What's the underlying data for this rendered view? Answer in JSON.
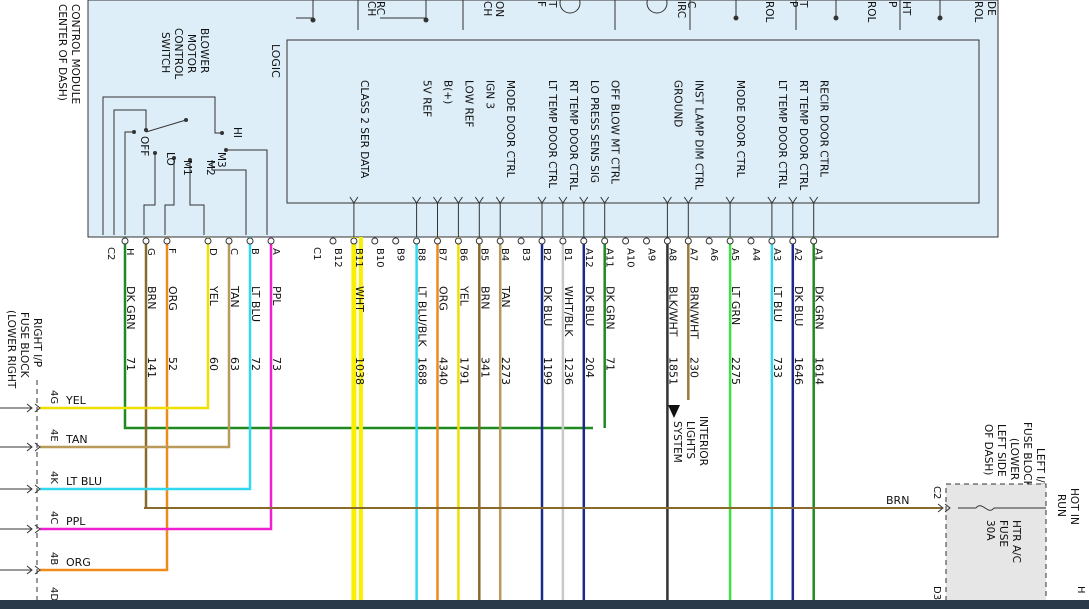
{
  "module": {
    "title_lines": [
      "CONTROL MODULE",
      "CENTER OF DASH)"
    ],
    "logic_label": "LOGIC",
    "top_labels": [
      "RC",
      "CH",
      "ON",
      "CH",
      "T",
      "F",
      "C",
      "IRC",
      "T",
      "P",
      "ROL",
      "HT",
      "P",
      "ROL",
      "DE",
      "ROL"
    ],
    "switch_title": [
      "BLOWER",
      "MOTOR",
      "CONTROL",
      "SWITCH"
    ],
    "switch_positions": [
      "HI",
      "OFF",
      "LO",
      "M1",
      "M2",
      "M3"
    ]
  },
  "connectors": {
    "c2": "C2",
    "c1": "C1"
  },
  "c2_wires": [
    {
      "pin": "H",
      "color_name": "DK GRN",
      "circuit": "71",
      "hex": "#1f8a1f"
    },
    {
      "pin": "G",
      "color_name": "BRN",
      "circuit": "141",
      "hex": "#8a6a2a"
    },
    {
      "pin": "F",
      "color_name": "ORG",
      "circuit": "52",
      "hex": "#f08a1a"
    },
    {
      "pin": "D",
      "color_name": "YEL",
      "circuit": "60",
      "hex": "#f0e000"
    },
    {
      "pin": "C",
      "color_name": "TAN",
      "circuit": "63",
      "hex": "#b89a5a"
    },
    {
      "pin": "B",
      "color_name": "LT BLU",
      "circuit": "72",
      "hex": "#30d8f0"
    },
    {
      "pin": "A",
      "color_name": "PPL",
      "circuit": "73",
      "hex": "#f020d0"
    }
  ],
  "c1_wires": [
    {
      "pin": "B12",
      "func": "",
      "color_name": "",
      "circuit": "",
      "hex": ""
    },
    {
      "pin": "B11",
      "func": "CLASS 2 SER DATA",
      "color_name": "WHT",
      "circuit": "1038",
      "hex": "#f8f000"
    },
    {
      "pin": "B10",
      "func": "",
      "color_name": "",
      "circuit": "",
      "hex": ""
    },
    {
      "pin": "B9",
      "func": "",
      "color_name": "",
      "circuit": "",
      "hex": ""
    },
    {
      "pin": "B8",
      "func": "5V REF",
      "color_name": "LT BLU/BLK",
      "circuit": "1688",
      "hex": "#30d8f0"
    },
    {
      "pin": "B7",
      "func": "B(+)",
      "color_name": "ORG",
      "circuit": "4340",
      "hex": "#f08a1a"
    },
    {
      "pin": "B6",
      "func": "LOW REF",
      "color_name": "YEL",
      "circuit": "1791",
      "hex": "#f0e000"
    },
    {
      "pin": "B5",
      "func": "IGN 3",
      "color_name": "BRN",
      "circuit": "341",
      "hex": "#8a6a2a"
    },
    {
      "pin": "B4",
      "func": "MODE DOOR CTRL",
      "color_name": "TAN",
      "circuit": "2273",
      "hex": "#b89a5a"
    },
    {
      "pin": "B3",
      "func": "",
      "color_name": "",
      "circuit": "",
      "hex": ""
    },
    {
      "pin": "B2",
      "func": "LT TEMP DOOR CTRL",
      "color_name": "DK BLU",
      "circuit": "1199",
      "hex": "#1a2a8a"
    },
    {
      "pin": "B1",
      "func": "RT TEMP DOOR CTRL",
      "color_name": "WHT/BLK",
      "circuit": "1236",
      "hex": "#c8c8c8"
    },
    {
      "pin": "A12",
      "func": "LO PRESS SENS SIG",
      "color_name": "DK BLU",
      "circuit": "204",
      "hex": "#1a2a8a"
    },
    {
      "pin": "A11",
      "func": "OFF BLOW MT CTRL",
      "color_name": "DK GRN",
      "circuit": "71",
      "hex": "#1f8a1f"
    },
    {
      "pin": "A10",
      "func": "",
      "color_name": "",
      "circuit": "",
      "hex": ""
    },
    {
      "pin": "A9",
      "func": "",
      "color_name": "",
      "circuit": "",
      "hex": ""
    },
    {
      "pin": "A8",
      "func": "GROUND",
      "color_name": "BLK/WHT",
      "circuit": "1851",
      "hex": "#333333"
    },
    {
      "pin": "A7",
      "func": "INST LAMP DIM CTRL",
      "color_name": "BRN/WHT",
      "circuit": "230",
      "hex": "#9a7a3a"
    },
    {
      "pin": "A6",
      "func": "",
      "color_name": "",
      "circuit": "",
      "hex": ""
    },
    {
      "pin": "A5",
      "func": "MODE DOOR CTRL",
      "color_name": "LT GRN",
      "circuit": "2275",
      "hex": "#40e040"
    },
    {
      "pin": "A4",
      "func": "",
      "color_name": "",
      "circuit": "",
      "hex": ""
    },
    {
      "pin": "A3",
      "func": "LT TEMP DOOR CTRL",
      "color_name": "LT BLU",
      "circuit": "733",
      "hex": "#30d8f0"
    },
    {
      "pin": "A2",
      "func": "RT TEMP DOOR CTRL",
      "color_name": "DK BLU",
      "circuit": "1646",
      "hex": "#1a2a8a"
    },
    {
      "pin": "A1",
      "func": "RECIR DOOR CTRL",
      "color_name": "DK GRN",
      "circuit": "1614",
      "hex": "#1f8a1f"
    }
  ],
  "interior_lights": [
    "INTERIOR",
    "LIGHTS",
    "SYSTEM"
  ],
  "right_fuse_block": {
    "title": [
      "RIGHT I/P",
      "FUSE BLOCK",
      "(LOWER RIGHT"
    ],
    "pins": [
      {
        "id": "4G",
        "wire": "YEL"
      },
      {
        "id": "4E",
        "wire": "TAN"
      },
      {
        "id": "4K",
        "wire": "LT BLU"
      },
      {
        "id": "4C",
        "wire": "PPL"
      },
      {
        "id": "4B",
        "wire": "ORG"
      },
      {
        "id": "4D",
        "wire": ""
      }
    ]
  },
  "left_fuse_block": {
    "title": [
      "LEFT I/P",
      "FUSE BLOCK",
      "(LOWER",
      "LEFT SIDE",
      "OF DASH)"
    ],
    "hot_label": [
      "HOT IN",
      "RUN"
    ],
    "fuse": [
      "HTR A/C",
      "FUSE",
      "30A"
    ],
    "connector_pin": "C2",
    "bottom_pin": "D3",
    "wire_label": "BRN",
    "h_fragment": "H"
  }
}
